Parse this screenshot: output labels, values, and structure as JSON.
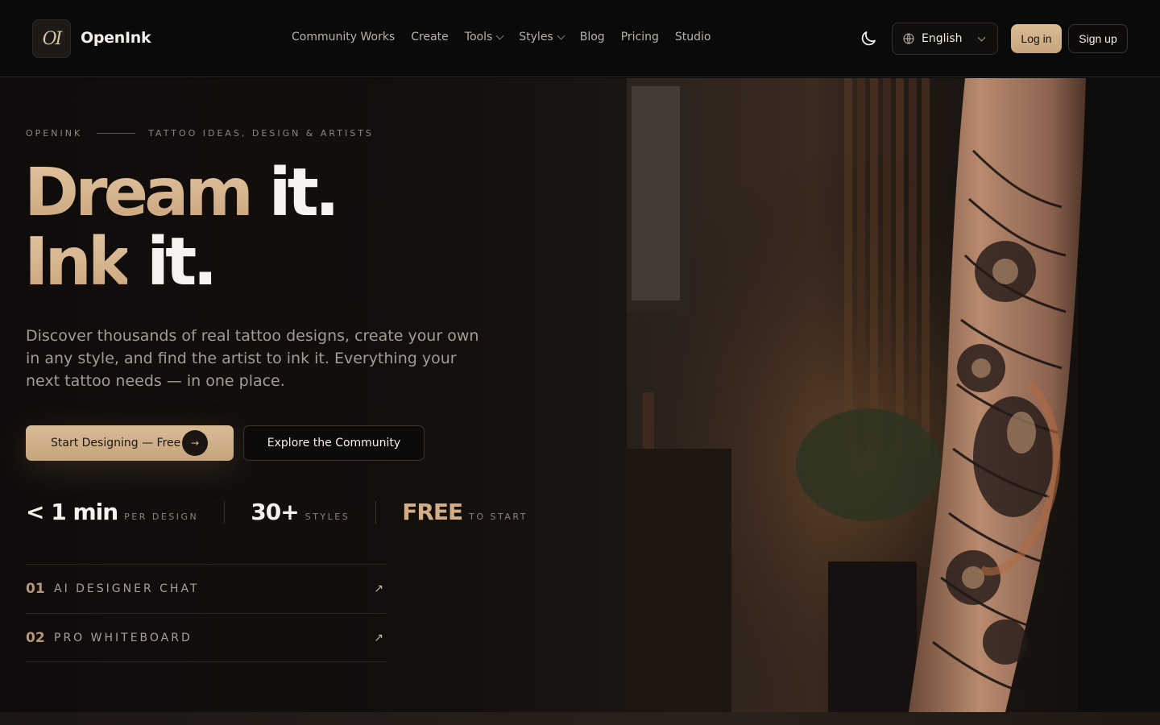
{
  "header": {
    "logo_text": "OI",
    "brand": "OpenInk",
    "nav": [
      {
        "label": "Community Works",
        "dropdown": false
      },
      {
        "label": "Create",
        "dropdown": false
      },
      {
        "label": "Tools",
        "dropdown": true
      },
      {
        "label": "Styles",
        "dropdown": true
      },
      {
        "label": "Blog",
        "dropdown": false
      },
      {
        "label": "Pricing",
        "dropdown": false
      },
      {
        "label": "Studio",
        "dropdown": false
      }
    ],
    "theme_icon": "moon-icon",
    "language": "English",
    "login_label": "Log in",
    "signup_label": "Sign up"
  },
  "hero": {
    "eyebrow_left": "OPENINK",
    "eyebrow_right": "TATTOO IDEAS, DESIGN & ARTISTS",
    "headline_1_gold": "Dream",
    "headline_1_white": "it.",
    "headline_2_gold": "Ink",
    "headline_2_white": "it.",
    "description": "Discover thousands of real tattoo designs, create your own in any style, and find the artist to ink it. Everything your next tattoo needs — in one place.",
    "primary_cta": "Start Designing — Free",
    "primary_cta_icon": "→",
    "secondary_cta": "Explore the Community",
    "stats": [
      {
        "value": "< 1 min",
        "label": "PER DESIGN"
      },
      {
        "value": "30+",
        "label": "STYLES"
      },
      {
        "value": "FREE",
        "label": "TO START"
      }
    ],
    "features": [
      {
        "num": "01",
        "title": "AI DESIGNER CHAT",
        "icon": "↗"
      },
      {
        "num": "02",
        "title": "PRO WHITEBOARD",
        "icon": "↗"
      }
    ]
  },
  "colors": {
    "accent": "#d2ae86",
    "background": "#0b0908"
  }
}
